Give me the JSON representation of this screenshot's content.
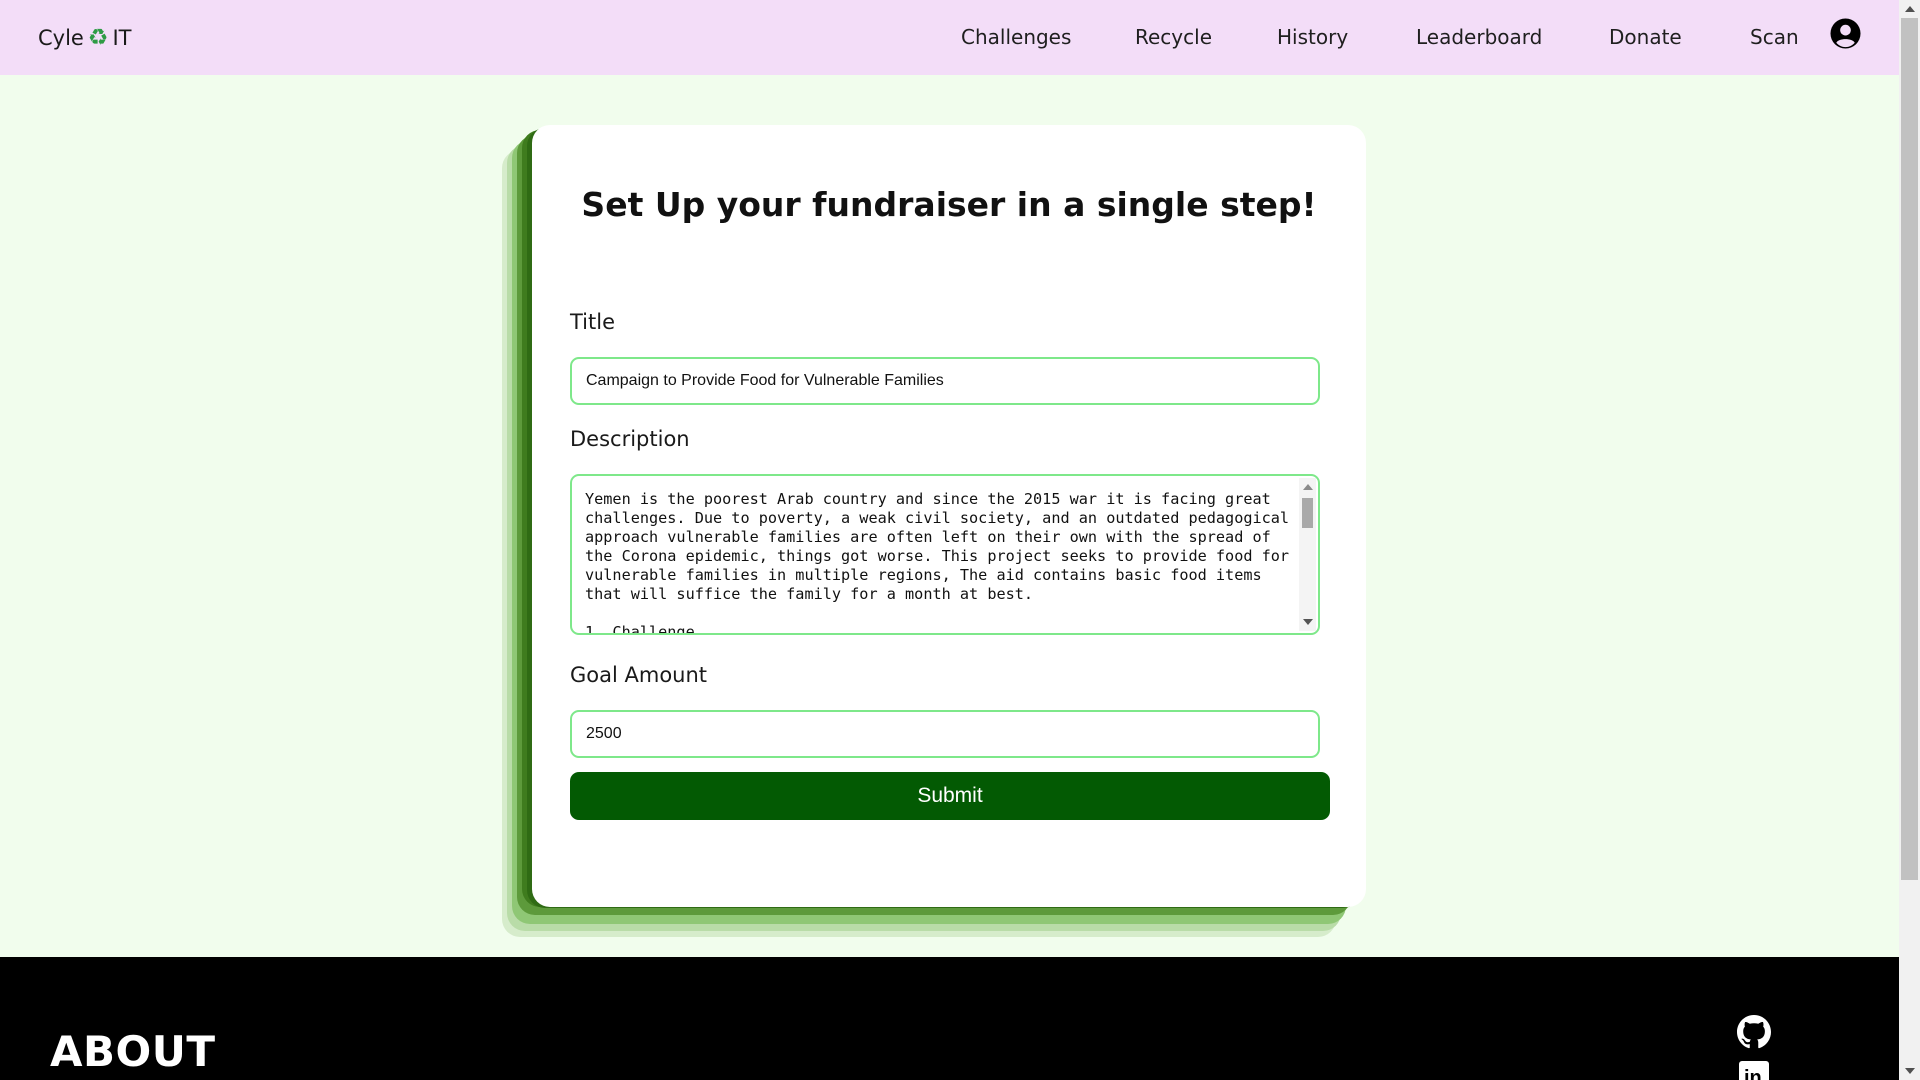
{
  "brand": {
    "left": "Cyle",
    "icon": "recycle-icon",
    "right": "IT"
  },
  "nav": {
    "items": [
      "Challenges",
      "Recycle",
      "History",
      "Leaderboard",
      "Donate",
      "Scan"
    ],
    "profile_icon": "user-circle-icon"
  },
  "form": {
    "heading": "Set Up your fundraiser in a single step!",
    "title_label": "Title",
    "title_value": "Campaign to Provide Food for Vulnerable Families",
    "description_label": "Description",
    "description_value": "Yemen is the poorest Arab country and since the 2015 war it is facing great challenges. Due to poverty, a weak civil society, and an outdated pedagogical approach vulnerable families are often left on their own with the spread of the Corona epidemic, things got worse. This project seeks to provide food for vulnerable families in multiple regions, The aid contains basic food items that will suffice the family for a month at best.\n\n1. Challenge",
    "goal_label": "Goal Amount",
    "goal_value": "2500",
    "submit_label": "Submit"
  },
  "footer": {
    "about_heading": "ABOUT",
    "icons": [
      "github-icon",
      "linkedin-icon"
    ]
  },
  "colors": {
    "nav_bg": "#f3ddf8",
    "page_bg": "#f1fded",
    "input_border": "#7ee88a",
    "submit_bg": "#035a03",
    "card_shadow_dark": "#2f6b14",
    "footer_bg": "#000000"
  }
}
